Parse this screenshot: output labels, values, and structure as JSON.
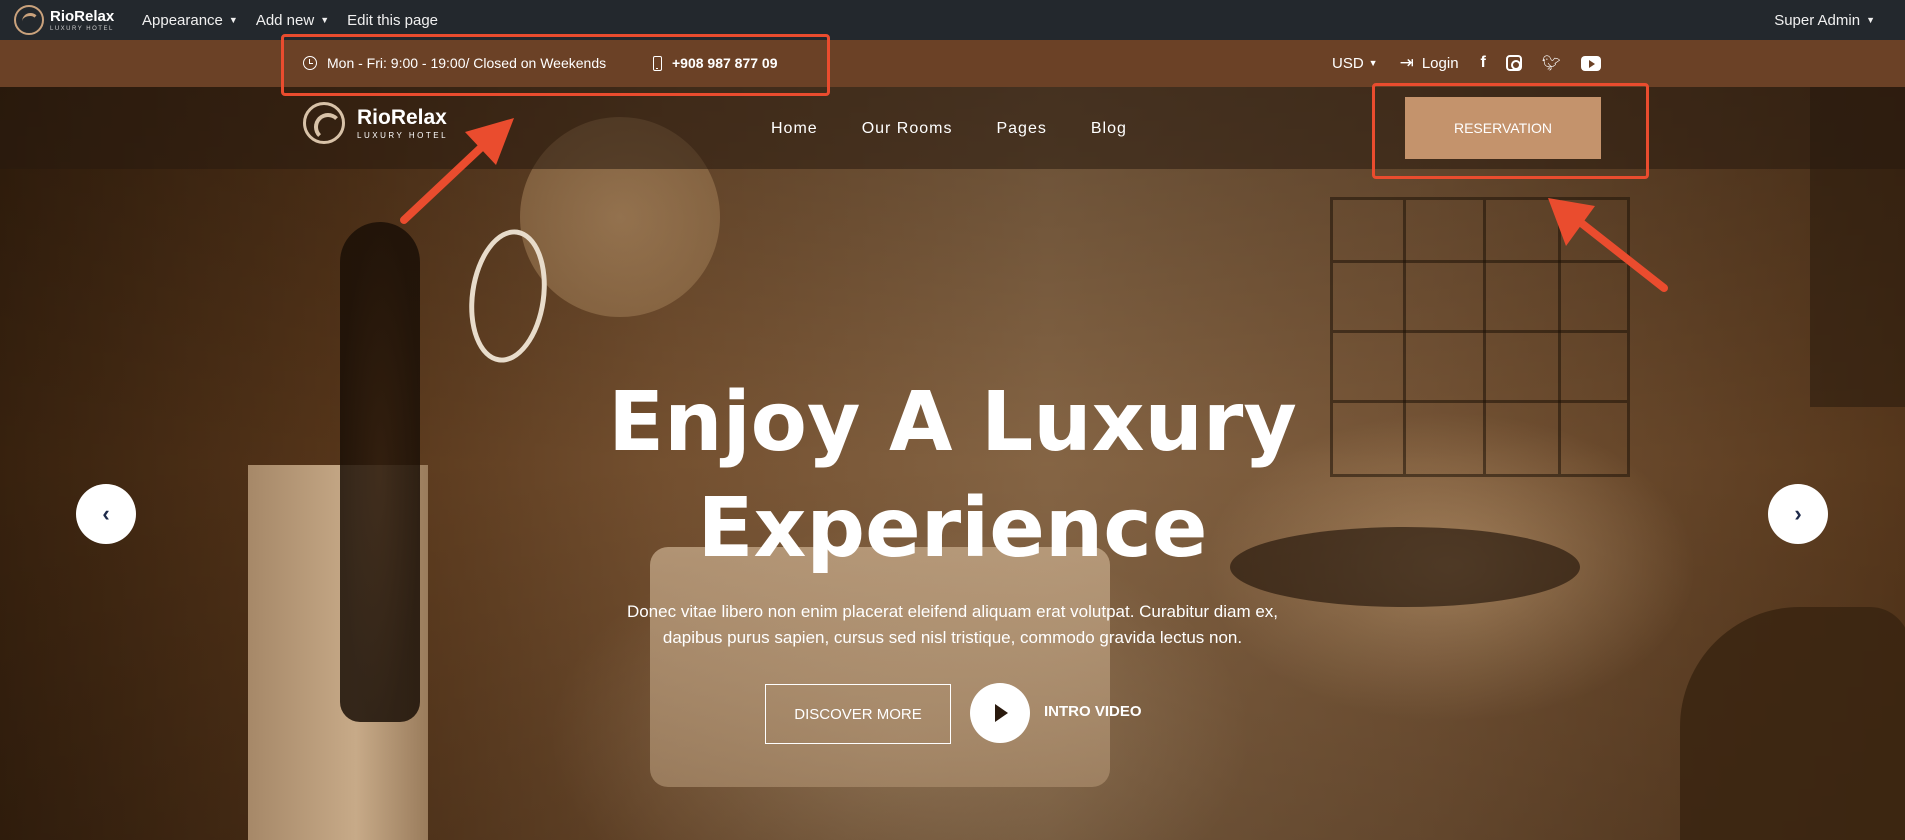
{
  "admin_bar": {
    "logo_title": "RioRelax",
    "logo_sub": "LUXURY HOTEL",
    "items": [
      {
        "label": "Appearance",
        "caret": "▼"
      },
      {
        "label": "Add new",
        "caret": "▼"
      },
      {
        "label": "Edit this page",
        "caret": ""
      }
    ],
    "user": "Super Admin",
    "user_caret": "▼"
  },
  "top_bar": {
    "hours": "Mon - Fri: 9:00 - 19:00/ Closed on Weekends",
    "phone": "+908 987 877 09",
    "currency": "USD",
    "currency_caret": "▼",
    "login": "Login",
    "socials": [
      "facebook-icon",
      "instagram-icon",
      "twitter-icon",
      "youtube-icon"
    ]
  },
  "nav": {
    "logo_title": "RioRelax",
    "logo_sub": "LUXURY HOTEL",
    "menu": [
      "Home",
      "Our Rooms",
      "Pages",
      "Blog"
    ],
    "reservation": "RESERVATION"
  },
  "hero": {
    "title_line1": "Enjoy A Luxury",
    "title_line2": "Experience",
    "desc_line1": "Donec vitae libero non enim placerat eleifend aliquam erat volutpat. Curabitur diam ex,",
    "desc_line2": "dapibus purus sapien, cursus sed nisl tristique, commodo gravida lectus non.",
    "discover": "DISCOVER MORE",
    "intro": "INTRO VIDEO",
    "prev_glyph": "‹",
    "next_glyph": "›"
  },
  "colors": {
    "admin_bg": "#23282d",
    "topbar_bg": "#6b4126",
    "accent": "#c4936c",
    "annotation": "#ea4c2e"
  }
}
